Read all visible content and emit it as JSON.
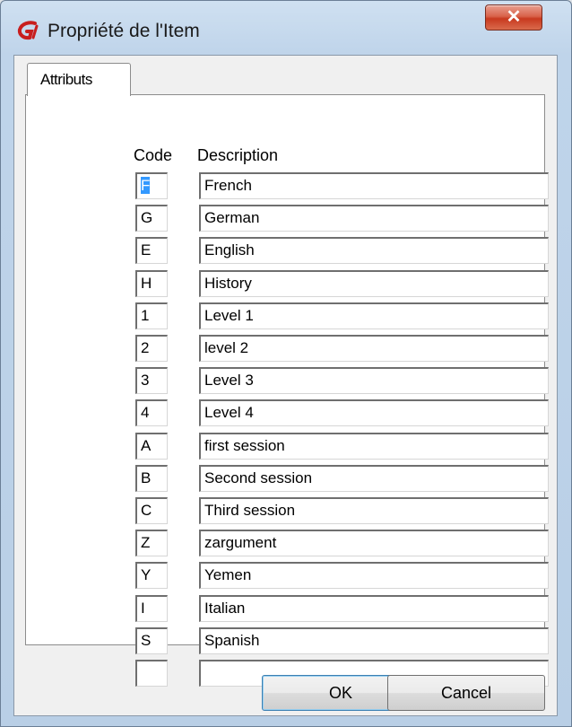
{
  "window": {
    "title": "Propriété de l'Item",
    "close_label": "✕"
  },
  "tabs": [
    {
      "label": "Attributs"
    }
  ],
  "table": {
    "headers": {
      "code": "Code",
      "description": "Description"
    },
    "rows": [
      {
        "code": "F",
        "description": "French"
      },
      {
        "code": "G",
        "description": "German"
      },
      {
        "code": "E",
        "description": "English"
      },
      {
        "code": "H",
        "description": "History"
      },
      {
        "code": "1",
        "description": "Level 1"
      },
      {
        "code": "2",
        "description": "level 2"
      },
      {
        "code": "3",
        "description": "Level 3"
      },
      {
        "code": "4",
        "description": "Level 4"
      },
      {
        "code": "A",
        "description": "first session"
      },
      {
        "code": "B",
        "description": "Second session"
      },
      {
        "code": "C",
        "description": "Third session"
      },
      {
        "code": "Z",
        "description": "zargument"
      },
      {
        "code": "Y",
        "description": "Yemen"
      },
      {
        "code": "I",
        "description": "Italian"
      },
      {
        "code": "S",
        "description": "Spanish"
      },
      {
        "code": "",
        "description": ""
      }
    ]
  },
  "buttons": {
    "ok": "OK",
    "cancel": "Cancel"
  }
}
